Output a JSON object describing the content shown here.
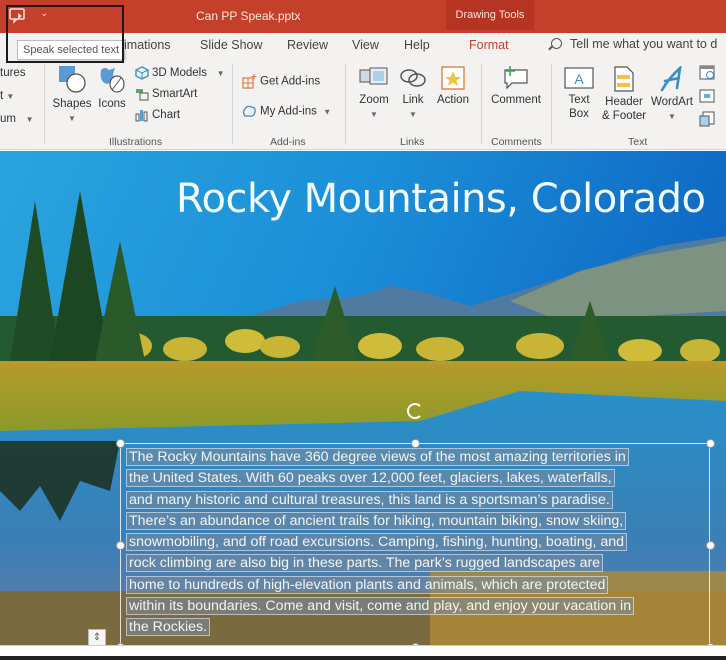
{
  "titlebar": {
    "document_title": "Can PP Speak.pptx",
    "context_tab": "Drawing Tools",
    "qat_more": "⌄"
  },
  "tooltip": {
    "text": "Speak selected text"
  },
  "tabs": [
    {
      "label": "imations",
      "active": false
    },
    {
      "label": "Slide Show",
      "active": false
    },
    {
      "label": "Review",
      "active": false
    },
    {
      "label": "View",
      "active": false
    },
    {
      "label": "Help",
      "active": false
    },
    {
      "label": "Format",
      "active": true
    }
  ],
  "tell_me": {
    "placeholder": "Tell me what you want to d"
  },
  "ribbon": {
    "left_partial": [
      "tures",
      "t",
      "um"
    ],
    "illustrations": {
      "label": "Illustrations",
      "shapes": "Shapes",
      "icons": "Icons",
      "models_3d": "3D Models",
      "smartart": "SmartArt",
      "chart": "Chart"
    },
    "addins": {
      "label": "Add-ins",
      "get": "Get Add-ins",
      "my": "My Add-ins"
    },
    "links": {
      "label": "Links",
      "zoom": "Zoom",
      "link": "Link",
      "action": "Action"
    },
    "comments": {
      "label": "Comments",
      "comment": "Comment"
    },
    "text": {
      "label": "Text",
      "textbox_1": "Text",
      "textbox_2": "Box",
      "header_1": "Header",
      "header_2": "& Footer",
      "wordart": "WordArt"
    }
  },
  "slide": {
    "title": "Rocky Mountains, Colorado",
    "body_lines": [
      "The Rocky Mountains have 360 degree views of the most amazing  territories in",
      "the United States. With 60 peaks over 12,000 feet, glaciers, lakes, waterfalls,",
      "and many historic and cultural treasures, this land is a sportsman’s paradise.",
      "There’s an abundance of ancient trails for hiking, mountain biking, snow skiing,",
      "snowmobiling, and off road excursions. Camping, fishing, hunting, boating, and",
      "rock climbing are also big in these parts. The park’s rugged landscapes are",
      "home to hundreds of high-elevation plants and animals, which are protected",
      "within its boundaries. Come and visit, come and play, and enjoy your vacation in",
      "the Rockies."
    ]
  },
  "colors": {
    "accent": "#c4402a",
    "ribbon_bg": "#f3f2f1",
    "format_tab": "#c4402a"
  }
}
